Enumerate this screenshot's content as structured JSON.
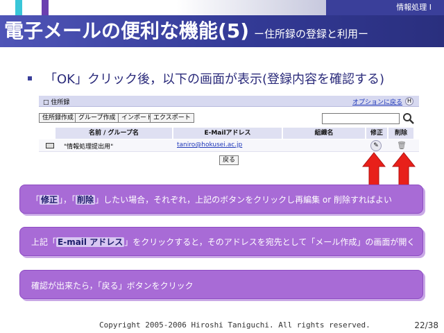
{
  "header": {
    "course": "情報処理 I",
    "title": "電子メールの便利な機能(5)",
    "subtitle": "ー住所録の登録と利用ー"
  },
  "headline": "「OK」クリック後，以下の画面が表示(登録内容を確認する)",
  "addressbook": {
    "title": "住所録",
    "return_link": "オプションに戻る",
    "help": "H",
    "buttons": [
      "住所録作成",
      "グループ作成",
      "インポート",
      "エクスポート"
    ],
    "search_value": "",
    "columns": [
      "名前 / グループ名",
      "E-Mailアドレス",
      "組織名",
      "修正",
      "削除"
    ],
    "rows": [
      {
        "name": "\"情報処理提出用\"",
        "email": "taniro@hokusei.ac.jp",
        "org": ""
      }
    ],
    "back_button": "戻る"
  },
  "notes": {
    "n1_pre": "「",
    "n1_edit": "修正",
    "n1_mid1": "」，「",
    "n1_delete": "削除",
    "n1_post": "」したい場合，それぞれ，上記のボタンをクリックし再編集 or 削除すればよい",
    "n2_pre": "上記「",
    "n2_em": "E-mail アドレス",
    "n2_post": "」をクリックすると，そのアドレスを宛先として「メール作成」の画面が開く",
    "n3": "確認が出来たら，「戻る」ボタンをクリック"
  },
  "footer": {
    "copyright": "Copyright 2005-2006 Hiroshi Taniguchi. All rights reserved.",
    "page": "22/38"
  },
  "colors": {
    "title_bar": "#333a96",
    "note_box": "#a86bd6",
    "arrow": "#e8201a"
  }
}
